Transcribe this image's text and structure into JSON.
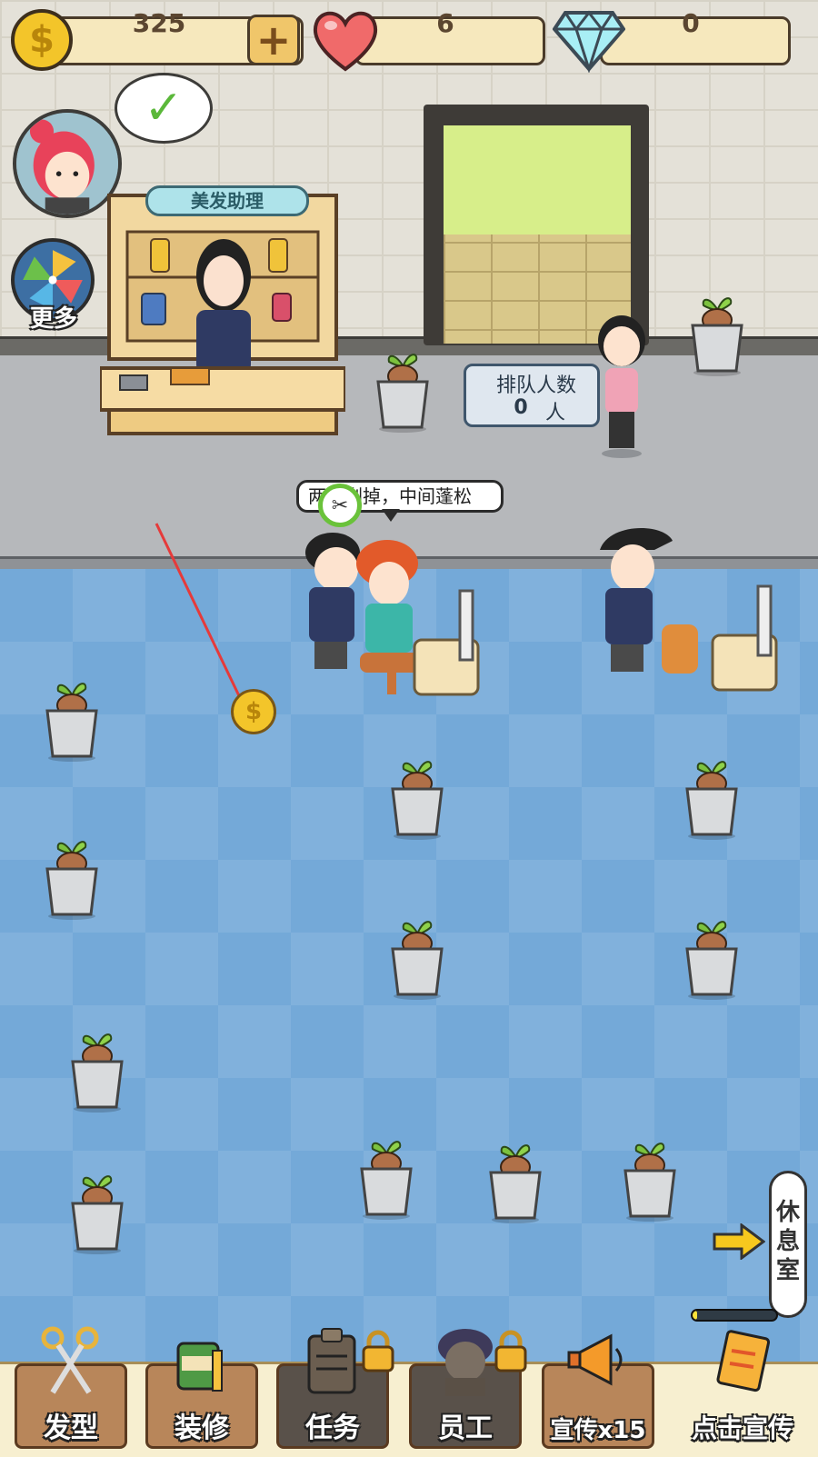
{
  "hud": {
    "coins": "325",
    "hearts": "6",
    "diamonds": "0"
  },
  "side_buttons": {
    "more_label": "更多"
  },
  "reception": {
    "sign": "美发助理"
  },
  "queue": {
    "title": "排队人数",
    "count": "0",
    "unit": "人"
  },
  "customer_request": "两侧剃掉，中间蓬松",
  "rest_room": {
    "label": "休息室",
    "progress": 0.05
  },
  "tabs": [
    {
      "label": "发型",
      "locked": false,
      "icon": "scissors-icon"
    },
    {
      "label": "装修",
      "locked": false,
      "icon": "paint-bucket-icon"
    },
    {
      "label": "任务",
      "locked": true,
      "icon": "clipboard-icon"
    },
    {
      "label": "员工",
      "locked": true,
      "icon": "staff-icon"
    },
    {
      "label": "宣传x15",
      "locked": false,
      "icon": "megaphone-icon"
    },
    {
      "label": "点击宣传",
      "locked": false,
      "icon": "flyer-icon"
    }
  ],
  "colors": {
    "floor": "#74a9d8",
    "coin": "#f3c52a",
    "heart": "#f06a6a",
    "diamond": "#8fe3ef"
  }
}
